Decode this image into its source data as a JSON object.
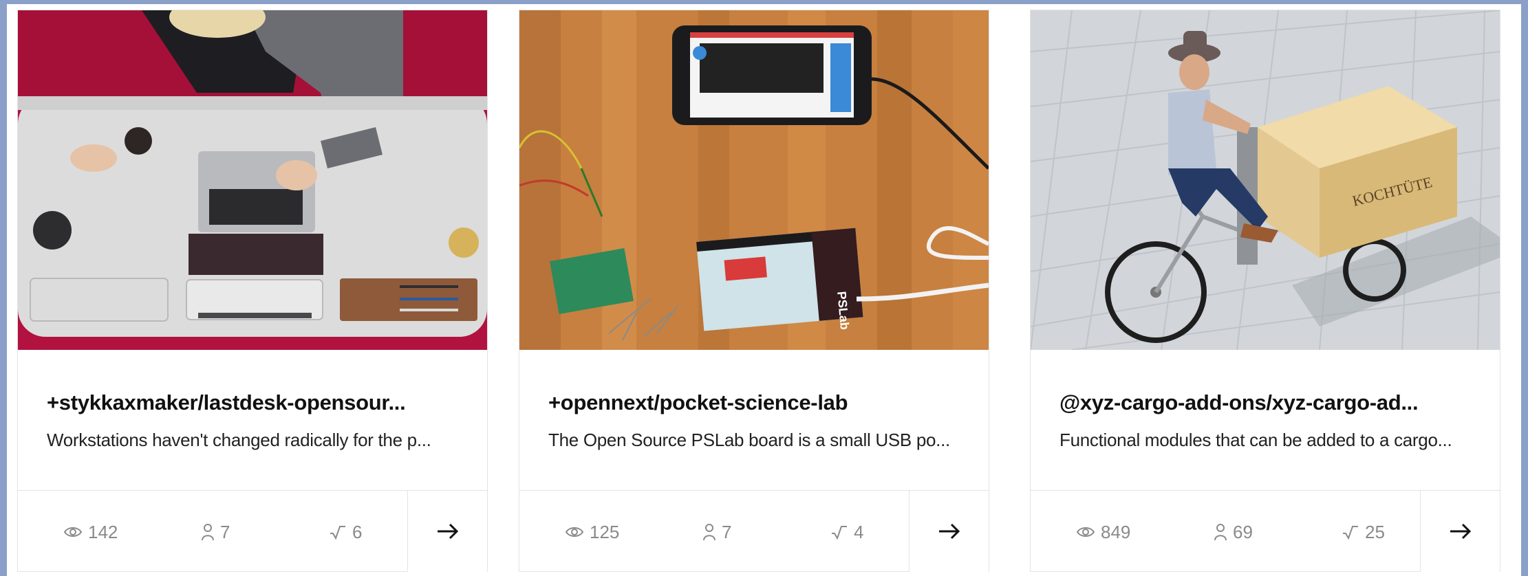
{
  "cards": [
    {
      "title": "+stykkaxmaker/lastdesk-opensour...",
      "description": "Workstations haven't changed radically for the p...",
      "views": "142",
      "members": "7",
      "versions": "6",
      "image": "desk-photo"
    },
    {
      "title": "+opennext/pocket-science-lab",
      "description": "The Open Source PSLab board is a small USB po...",
      "views": "125",
      "members": "7",
      "versions": "4",
      "image": "pslab-photo",
      "image_text": "PSLab"
    },
    {
      "title": "@xyz-cargo-add-ons/xyz-cargo-ad...",
      "description": "Functional modules that can be added to a cargo...",
      "views": "849",
      "members": "69",
      "versions": "25",
      "image": "cargo-bike-photo",
      "image_text": "KOCHTÜTE"
    }
  ],
  "icons": {
    "views": "eye-icon",
    "members": "person-icon",
    "versions": "version-icon",
    "open": "arrow-right-icon"
  },
  "colors": {
    "background": "#8aa0c8",
    "card_border": "#e3e3e3",
    "title": "#111111",
    "stat_text": "#8a8a8a"
  }
}
